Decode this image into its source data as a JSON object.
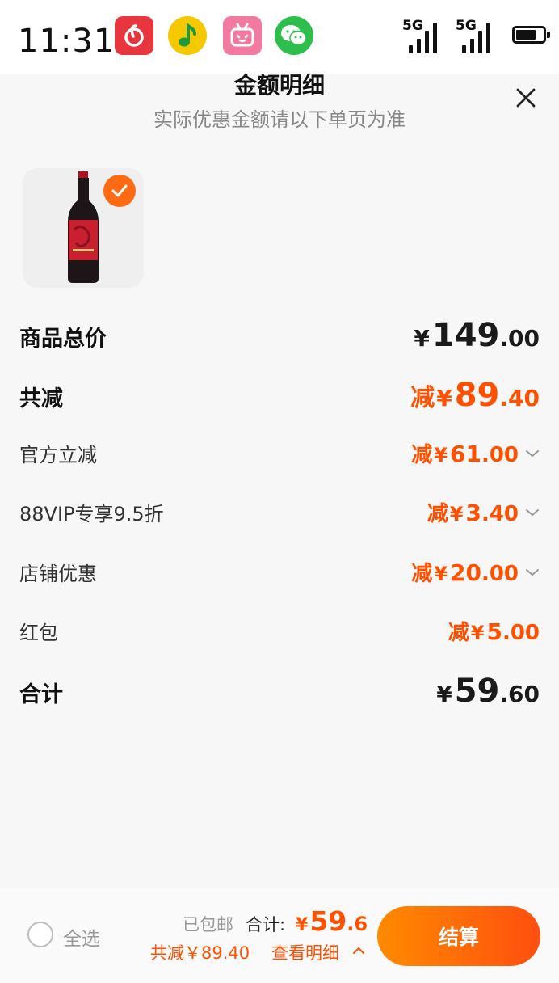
{
  "status_bar": {
    "time": "11:31",
    "apps": [
      "netease-music-icon",
      "qq-music-icon",
      "bilibili-icon",
      "wechat-icon"
    ],
    "signal1_label": "5G",
    "signal2_label": "5G",
    "battery_level": 0.75
  },
  "header": {
    "title": "金额明细",
    "subtitle": "实际优惠金额请以下单页为准"
  },
  "product": {
    "image": "red-wine-bottle",
    "selected": true
  },
  "rows": [
    {
      "label": "商品总价",
      "prefix": "",
      "yen": "¥",
      "int": "149",
      "dec": ".00",
      "color": "#1a1a1a"
    },
    {
      "label": "共减",
      "prefix": "减",
      "yen": "¥",
      "int": "89",
      "dec": ".40",
      "color": "#ff5000"
    },
    {
      "label": "官方立减",
      "prefix": "减",
      "yen": "¥",
      "int": "61",
      "dec": ".00",
      "color": "#ff5000",
      "expandable": true
    },
    {
      "label": "88VIP专享9.5折",
      "prefix": "减",
      "yen": "¥",
      "int": "3",
      "dec": ".40",
      "color": "#ff5000",
      "expandable": true
    },
    {
      "label": "店铺优惠",
      "prefix": "减",
      "yen": "¥",
      "int": "20",
      "dec": ".00",
      "color": "#ff5000",
      "expandable": true
    },
    {
      "label": "红包",
      "prefix": "减",
      "yen": "¥",
      "int": "5",
      "dec": ".00",
      "color": "#ff5000"
    },
    {
      "label": "合计",
      "prefix": "",
      "yen": "¥",
      "int": "59",
      "dec": ".60",
      "color": "#1a1a1a"
    }
  ],
  "bottom_bar": {
    "select_all": "全选",
    "shipping": "已包邮",
    "total_label": "合计:",
    "total_yen": "¥",
    "total_int": "59",
    "total_dec": ".6",
    "saved": "共减￥89.40",
    "detail": "查看明细",
    "checkout": "结算"
  },
  "colors": {
    "accent": "#ff5000",
    "checkout_gradient_start": "#ff8a00",
    "checkout_gradient_end": "#ff4f0f"
  }
}
